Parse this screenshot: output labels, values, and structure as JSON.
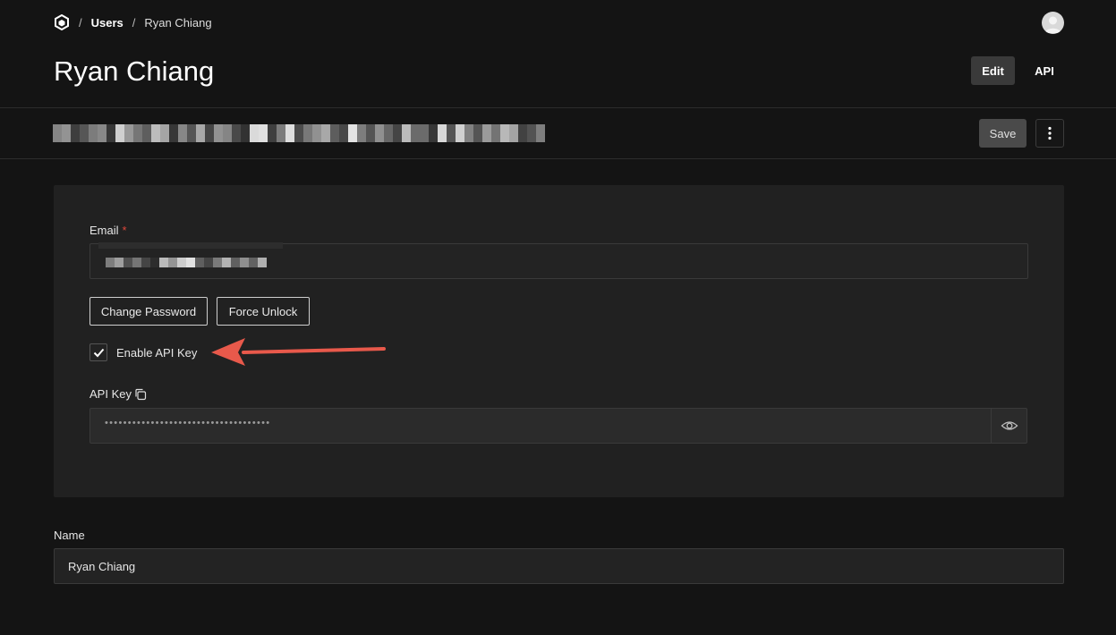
{
  "breadcrumb": {
    "users": "Users",
    "current": "Ryan Chiang",
    "separator": "/"
  },
  "header": {
    "title": "Ryan Chiang",
    "edit_label": "Edit",
    "api_label": "API"
  },
  "toolbar": {
    "save_label": "Save"
  },
  "form": {
    "email_label": "Email",
    "required_mark": "*",
    "change_password_label": "Change Password",
    "force_unlock_label": "Force Unlock",
    "enable_api_key_label": "Enable API Key",
    "enable_api_key_checked": true,
    "api_key_label": "API Key",
    "api_key_masked": "••••••••••••••••••••••••••••••••••••",
    "name_label": "Name",
    "name_value": "Ryan Chiang"
  },
  "colors": {
    "background": "#141414",
    "panel": "#212121",
    "required": "#e0483b",
    "annotation_arrow": "#e8594b"
  }
}
